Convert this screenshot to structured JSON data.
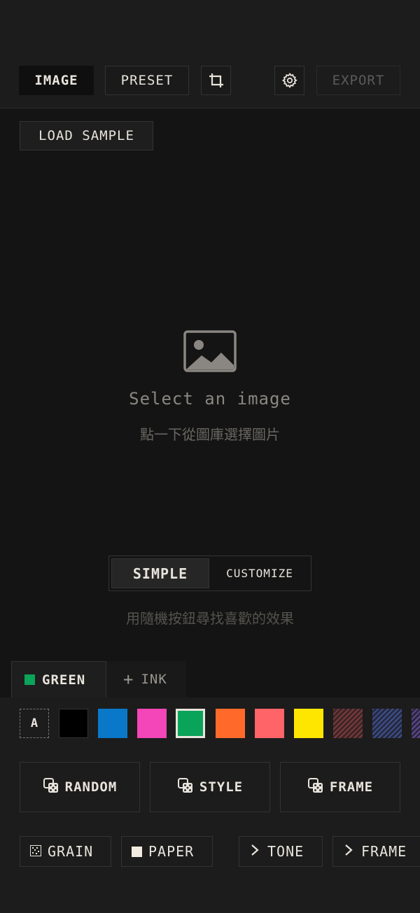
{
  "toolbar": {
    "image_label": "IMAGE",
    "preset_label": "PRESET",
    "crop_icon": "crop-icon",
    "settings_icon": "gear-icon",
    "export_label": "EXPORT"
  },
  "load_sample_label": "LOAD SAMPLE",
  "placeholder": {
    "icon": "image-icon",
    "title": "Select an image",
    "subtitle": "點一下從圖庫選擇圖片"
  },
  "mode": {
    "simple_label": "SIMPLE",
    "customize_label": "CUSTOMIZE",
    "hint": "用隨機按鈕尋找喜歡的效果"
  },
  "tabs": {
    "green_label": "GREEN",
    "ink_label": "INK",
    "green_color": "#0aa35a"
  },
  "swatches": {
    "auto_label": "A",
    "colors": [
      "#000000",
      "#0a78c8",
      "#f446b8",
      "#0aa35a",
      "#ff6a2a",
      "#ff6468",
      "#ffe600"
    ],
    "selected": "#0aa35a"
  },
  "actions": {
    "random_label": "RANDOM",
    "style_label": "STYLE",
    "frame_label": "FRAME"
  },
  "bottom": {
    "grain_label": "GRAIN",
    "paper_label": "PAPER",
    "tone_label": "TONE",
    "frame_label": "FRAME"
  }
}
